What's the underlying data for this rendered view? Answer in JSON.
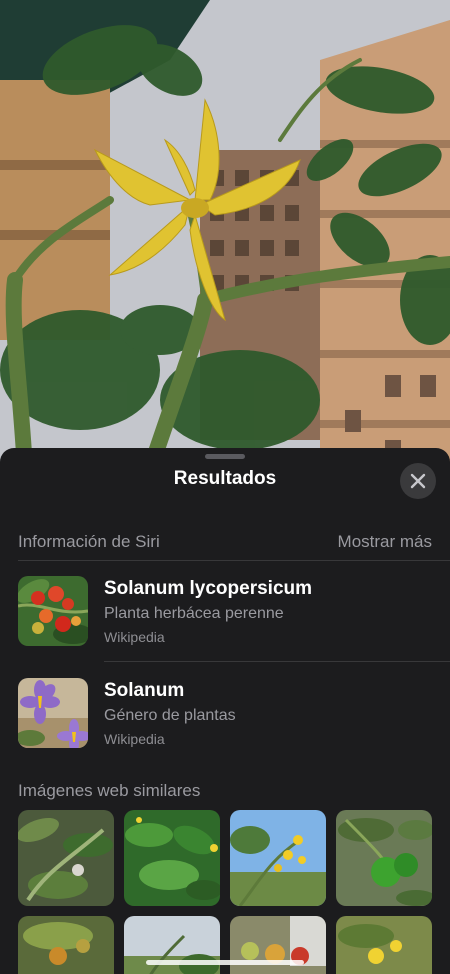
{
  "photo": {
    "subject": "tomato-flower-photo"
  },
  "sheet": {
    "title": "Resultados",
    "close_icon": "close-icon"
  },
  "siri_section": {
    "label": "Información de Siri",
    "show_more": "Mostrar más",
    "results": [
      {
        "title": "Solanum lycopersicum",
        "subtitle": "Planta herbácea perenne",
        "source": "Wikipedia",
        "thumb": "tomato-plant-thumbnail"
      },
      {
        "title": "Solanum",
        "subtitle": "Género de plantas",
        "source": "Wikipedia",
        "thumb": "purple-flower-thumbnail"
      }
    ]
  },
  "web_section": {
    "label": "Imágenes web similares",
    "images": [
      "tomato-plant-image",
      "green-leaves-image",
      "yellow-flowers-sky-image",
      "green-tomato-image",
      "tomato-fruits-image",
      "plant-garden-image",
      "cherry-tomatoes-image",
      "yellow-flower-image"
    ]
  }
}
